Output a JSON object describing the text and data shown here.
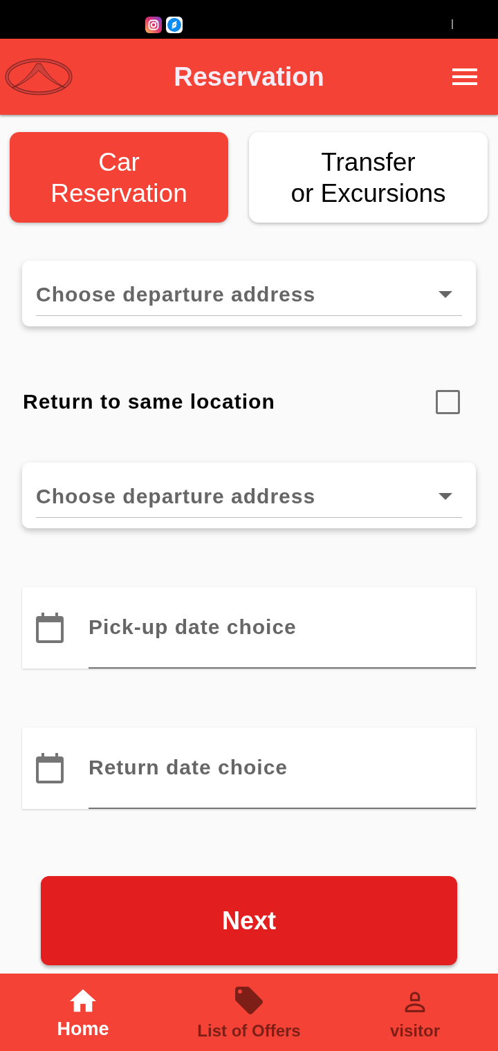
{
  "app_bar": {
    "title": "Reservation"
  },
  "tabs": [
    {
      "label": "Car\nReservation",
      "selected": true
    },
    {
      "label": "Transfer\nor Excursions",
      "selected": false
    }
  ],
  "form": {
    "fields": [
      {
        "kind": "dropdown",
        "placeholder": "Choose departure address"
      },
      {
        "kind": "checkbox",
        "label": "Return to same location",
        "checked": false
      },
      {
        "kind": "dropdown",
        "placeholder": "Choose departure address"
      },
      {
        "kind": "date",
        "placeholder": "Pick-up date choice"
      },
      {
        "kind": "date",
        "placeholder": "Return date choice"
      }
    ]
  },
  "next_button": {
    "label": "Next"
  },
  "bottom_nav": [
    {
      "label": "Home",
      "selected": true
    },
    {
      "label": "List of Offers",
      "selected": false
    },
    {
      "label": "visitor",
      "selected": false
    }
  ]
}
